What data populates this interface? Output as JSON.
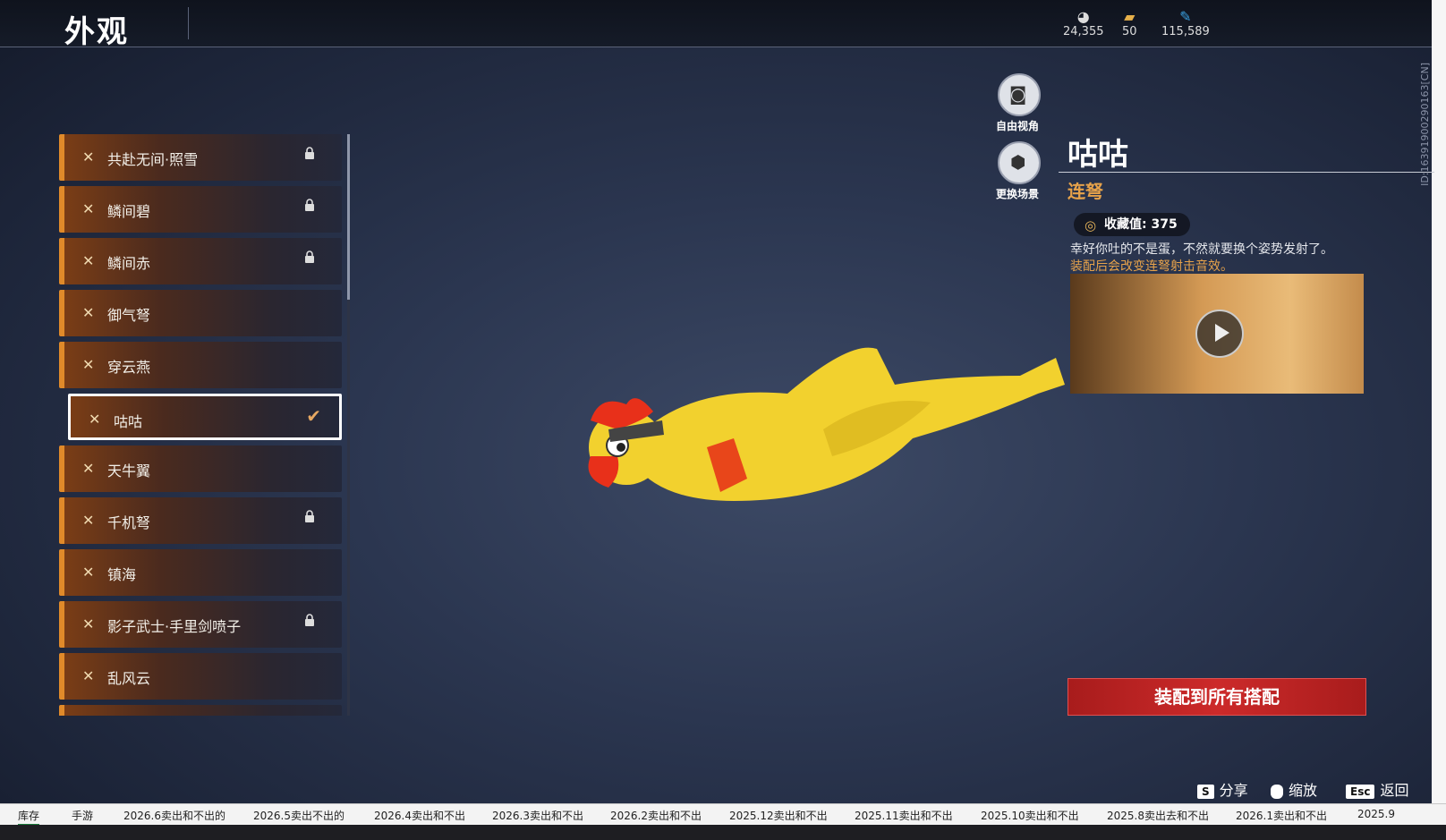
{
  "header": {
    "title": "外观"
  },
  "currencies": [
    {
      "icon": "coin-stack-icon",
      "value": "24,355"
    },
    {
      "icon": "ticket-icon",
      "value": "50"
    },
    {
      "icon": "feather-icon",
      "value": "115,589"
    }
  ],
  "side_id": "ID:16391900290163[CN]",
  "skins": [
    {
      "label": "共赴无间·照雪",
      "locked": true
    },
    {
      "label": "鳞间碧",
      "locked": true
    },
    {
      "label": "鳞间赤",
      "locked": true
    },
    {
      "label": "御气弩",
      "locked": false
    },
    {
      "label": "穿云燕",
      "locked": false
    },
    {
      "label": "咕咕",
      "locked": false,
      "selected": true
    },
    {
      "label": "天牛翼",
      "locked": false
    },
    {
      "label": "千机弩",
      "locked": true
    },
    {
      "label": "镇海",
      "locked": false
    },
    {
      "label": "影子武士·手里剑喷子",
      "locked": true
    },
    {
      "label": "乱风云",
      "locked": false
    }
  ],
  "tools": {
    "free_view": "自由视角",
    "change_scene": "更换场景"
  },
  "detail": {
    "name": "咕咕",
    "type": "连弩",
    "collect_label": "收藏值:",
    "collect_value": "375",
    "desc": "幸好你吐的不是蛋，不然就要换个姿势发射了。",
    "effect": "装配后会改变连弩射击音效。"
  },
  "equip_all": "装配到所有搭配",
  "hints": [
    {
      "key": "S",
      "label": "分享"
    },
    {
      "key": "",
      "label": "缩放"
    },
    {
      "key": "Esc",
      "label": "返回"
    }
  ],
  "sheet_tabs": [
    "库存",
    "手游",
    "2026.6卖出和不出的",
    "2026.5卖出不出的",
    "2026.4卖出和不出",
    "2026.3卖出和不出",
    "2026.2卖出和不出",
    "2025.12卖出和不出",
    "2025.11卖出和不出",
    "2025.10卖出和不出",
    "2025.8卖出去和不出",
    "2026.1卖出和不出",
    "2025.9"
  ]
}
